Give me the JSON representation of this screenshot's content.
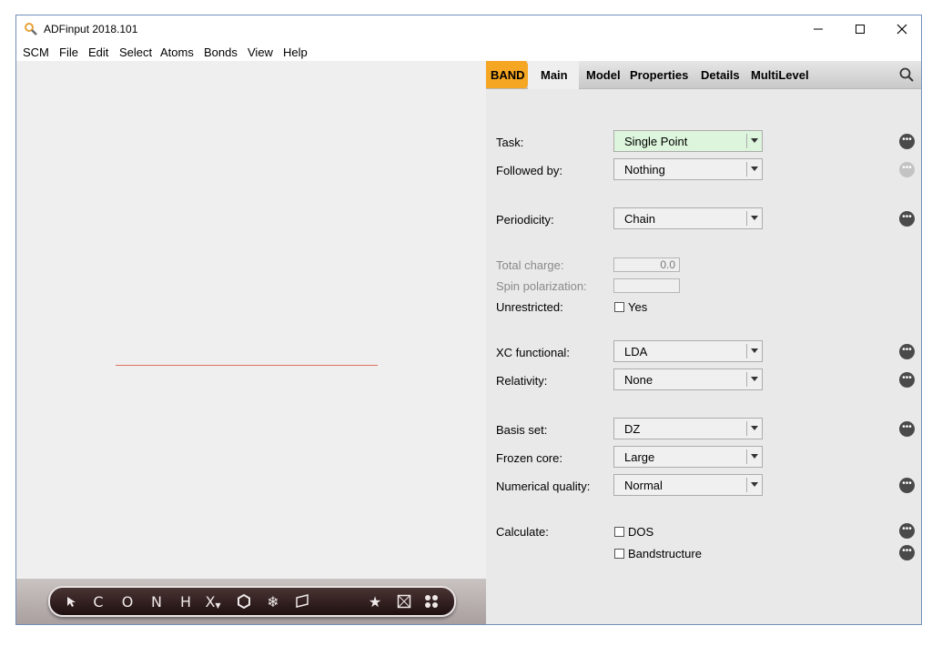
{
  "window": {
    "title": "ADFinput 2018.101"
  },
  "menu": {
    "items": [
      "SCM",
      "File",
      "Edit",
      "Select",
      "Atoms",
      "Bonds",
      "View",
      "Help"
    ]
  },
  "tabs": {
    "band": "BAND",
    "main": "Main",
    "model": "Model",
    "properties": "Properties",
    "details": "Details",
    "multilevel": "MultiLevel"
  },
  "form": {
    "task": {
      "label": "Task:",
      "value": "Single Point"
    },
    "followed_by": {
      "label": "Followed by:",
      "value": "Nothing"
    },
    "periodicity": {
      "label": "Periodicity:",
      "value": "Chain"
    },
    "total_charge": {
      "label": "Total charge:",
      "value": "0.0"
    },
    "spin_polarization": {
      "label": "Spin polarization:",
      "value": ""
    },
    "unrestricted": {
      "label": "Unrestricted:",
      "option": "Yes",
      "checked": false
    },
    "xc_functional": {
      "label": "XC functional:",
      "value": "LDA"
    },
    "relativity": {
      "label": "Relativity:",
      "value": "None"
    },
    "basis_set": {
      "label": "Basis set:",
      "value": "DZ"
    },
    "frozen_core": {
      "label": "Frozen core:",
      "value": "Large"
    },
    "numerical_quality": {
      "label": "Numerical quality:",
      "value": "Normal"
    },
    "calculate": {
      "label": "Calculate:",
      "options": [
        "DOS",
        "Bandstructure"
      ]
    }
  },
  "toolbar": {
    "tools": [
      "select-arrow",
      "C",
      "O",
      "N",
      "H",
      "X",
      "ring",
      "freeze",
      "plane",
      "star",
      "box",
      "dots"
    ],
    "labels": {
      "c": "C",
      "o": "O",
      "n": "N",
      "h": "H",
      "x": "X"
    }
  },
  "colors": {
    "band_tab": "#f5a623",
    "task_combo_bg": "#dcf5dc",
    "bond_line": "#e07060"
  }
}
